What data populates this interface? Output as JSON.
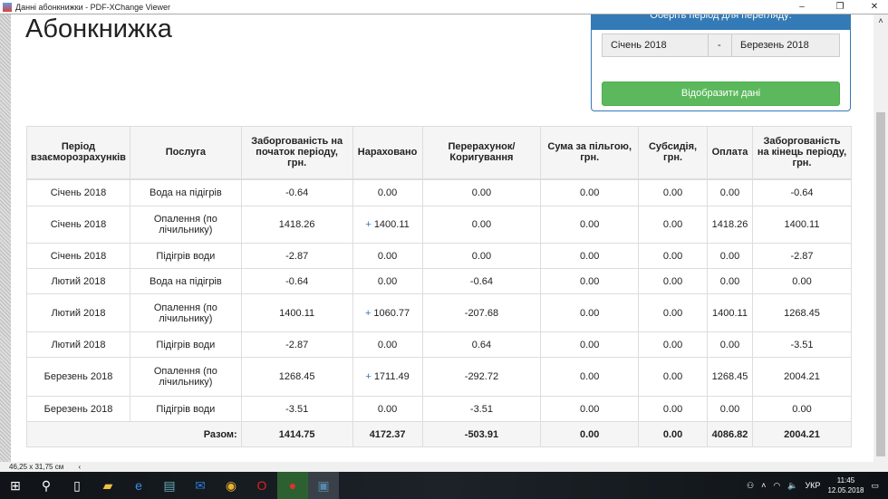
{
  "window": {
    "title": "Данні абонкнижки - PDF-XChange Viewer"
  },
  "page": {
    "heading": "Абонкнижка"
  },
  "panel": {
    "header": "Оберіть період для перегляду:",
    "from": "Січень 2018",
    "separator": "-",
    "to": "Березень 2018",
    "button": "Відобразити дані"
  },
  "table": {
    "headers": [
      "Період взаєморозрахунків",
      "Послуга",
      "Заборгованість на початок періоду, грн.",
      "Нараховано",
      "Перерахунок/ Коригування",
      "Сума за пільгою, грн.",
      "Субсидія, грн.",
      "Оплата",
      "Заборгованість на кінець періоду, грн."
    ],
    "rows": [
      [
        "Січень 2018",
        "Вода на підігрів",
        "-0.64",
        "0.00",
        "0.00",
        "0.00",
        "0.00",
        "0.00",
        "-0.64"
      ],
      [
        "Січень 2018",
        "Опалення (по лічильнику)",
        "1418.26",
        "1400.11",
        "0.00",
        "0.00",
        "0.00",
        "1418.26",
        "1400.11"
      ],
      [
        "Січень 2018",
        "Підігрів води",
        "-2.87",
        "0.00",
        "0.00",
        "0.00",
        "0.00",
        "0.00",
        "-2.87"
      ],
      [
        "Лютий 2018",
        "Вода на підігрів",
        "-0.64",
        "0.00",
        "-0.64",
        "0.00",
        "0.00",
        "0.00",
        "0.00"
      ],
      [
        "Лютий 2018",
        "Опалення (по лічильнику)",
        "1400.11",
        "1060.77",
        "-207.68",
        "0.00",
        "0.00",
        "1400.11",
        "1268.45"
      ],
      [
        "Лютий 2018",
        "Підігрів води",
        "-2.87",
        "0.00",
        "0.64",
        "0.00",
        "0.00",
        "0.00",
        "-3.51"
      ],
      [
        "Березень 2018",
        "Опалення (по лічильнику)",
        "1268.45",
        "1711.49",
        "-292.72",
        "0.00",
        "0.00",
        "1268.45",
        "2004.21"
      ],
      [
        "Березень 2018",
        "Підігрів води",
        "-3.51",
        "0.00",
        "-3.51",
        "0.00",
        "0.00",
        "0.00",
        "0.00"
      ]
    ],
    "expandable": [
      false,
      true,
      false,
      false,
      true,
      false,
      true,
      false
    ],
    "plus": "+",
    "total": {
      "label": "Разом:",
      "values": [
        "1414.75",
        "4172.37",
        "-503.91",
        "0.00",
        "0.00",
        "4086.82",
        "2004.21"
      ]
    }
  },
  "statusbar": {
    "size": "46,25 x 31,75 см"
  },
  "taskbar": {
    "lang": "УКР",
    "time": "11:45",
    "date": "12.05.2018"
  }
}
